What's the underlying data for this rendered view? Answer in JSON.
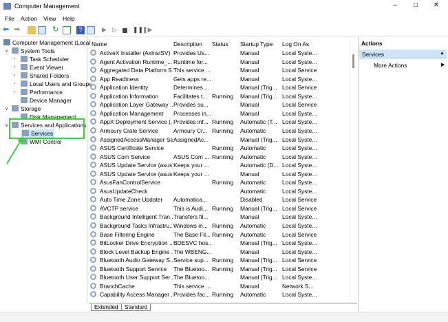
{
  "window": {
    "title": "Computer Management"
  },
  "menu": [
    "File",
    "Action",
    "View",
    "Help"
  ],
  "tree": {
    "root": "Computer Management (Local",
    "items": [
      {
        "label": "System Tools",
        "level": 1,
        "chev": "v"
      },
      {
        "label": "Task Scheduler",
        "level": 2,
        "chev": ">"
      },
      {
        "label": "Event Viewer",
        "level": 2,
        "chev": ">"
      },
      {
        "label": "Shared Folders",
        "level": 2,
        "chev": ">"
      },
      {
        "label": "Local Users and Groups",
        "level": 2,
        "chev": ">"
      },
      {
        "label": "Performance",
        "level": 2,
        "chev": ">"
      },
      {
        "label": "Device Manager",
        "level": 2,
        "chev": ""
      },
      {
        "label": "Storage",
        "level": 1,
        "chev": "v"
      },
      {
        "label": "Disk Management",
        "level": 2,
        "chev": ""
      },
      {
        "label": "Services and Applications",
        "level": 1,
        "chev": "v"
      },
      {
        "label": "Services",
        "level": 2,
        "chev": "",
        "selected": true
      },
      {
        "label": "WMI Control",
        "level": 2,
        "chev": ""
      }
    ]
  },
  "columns": [
    "Name",
    "Description",
    "Status",
    "Startup Type",
    "Log On As"
  ],
  "services": [
    [
      "ActiveX Installer (AxInstSV)",
      "Provides Us...",
      "",
      "Manual",
      "Local Syste..."
    ],
    [
      "Agent Activation Runtime_...",
      "Runtime for...",
      "",
      "Manual",
      "Local Syste..."
    ],
    [
      "Aggregated Data Platform S...",
      "This service ...",
      "",
      "Manual",
      "Local Service"
    ],
    [
      "App Readiness",
      "Gets apps re...",
      "",
      "Manual",
      "Local Syste..."
    ],
    [
      "Application Identity",
      "Determines ...",
      "",
      "Manual (Trig...",
      "Local Service"
    ],
    [
      "Application Information",
      "Facilitates t...",
      "Running",
      "Manual (Trig...",
      "Local Syste..."
    ],
    [
      "Application Layer Gateway ...",
      "Provides su...",
      "",
      "Manual",
      "Local Service"
    ],
    [
      "Application Management",
      "Processes in...",
      "",
      "Manual",
      "Local Syste..."
    ],
    [
      "AppX Deployment Service (...",
      "Provides inf...",
      "Running",
      "Automatic (T...",
      "Local Syste..."
    ],
    [
      "Armoury Crate Service",
      "Armoury Cr...",
      "Running",
      "Automatic",
      "Local Syste..."
    ],
    [
      "AssignedAccessManager Se...",
      "AssignedAc...",
      "",
      "Manual (Trig...",
      "Local Syste..."
    ],
    [
      "ASUS Certificate Service",
      "",
      "Running",
      "Automatic",
      "Local Syste..."
    ],
    [
      "ASUS Com Service",
      "ASUS Com ...",
      "Running",
      "Automatic",
      "Local Syste..."
    ],
    [
      "ASUS Update Service (asus)",
      "Keeps your ...",
      "",
      "Automatic (D...",
      "Local Syste..."
    ],
    [
      "ASUS Update Service (asusm)",
      "Keeps your ...",
      "",
      "Manual",
      "Local Syste..."
    ],
    [
      "AsusFanControlService",
      "",
      "Running",
      "Automatic",
      "Local Syste..."
    ],
    [
      "AsusUpdateCheck",
      "",
      "",
      "Automatic",
      "Local Syste..."
    ],
    [
      "Auto Time Zone Updater",
      "Automatica...",
      "",
      "Disabled",
      "Local Service"
    ],
    [
      "AVCTP service",
      "This is Audi...",
      "Running",
      "Manual (Trig...",
      "Local Service"
    ],
    [
      "Background Intelligent Tran...",
      "Transfers fil...",
      "",
      "Manual",
      "Local Syste..."
    ],
    [
      "Background Tasks Infrastru...",
      "Windows in...",
      "Running",
      "Automatic",
      "Local Syste..."
    ],
    [
      "Base Filtering Engine",
      "The Base Fil...",
      "Running",
      "Automatic",
      "Local Service"
    ],
    [
      "BitLocker Drive Encryption ...",
      "BDESVC hos...",
      "",
      "Manual (Trig...",
      "Local Syste..."
    ],
    [
      "Block Level Backup Engine ...",
      "The WBENG...",
      "",
      "Manual",
      "Local Syste..."
    ],
    [
      "Bluetooth Audio Gateway S...",
      "Service sup...",
      "Running",
      "Manual (Trig...",
      "Local Service"
    ],
    [
      "Bluetooth Support Service",
      "The Bluetoo...",
      "Running",
      "Manual (Trig...",
      "Local Service"
    ],
    [
      "Bluetooth User Support Ser...",
      "The Bluetoo...",
      "",
      "Manual (Trig...",
      "Local Syste..."
    ],
    [
      "BranchCache",
      "This service ...",
      "",
      "Manual",
      "Network S..."
    ],
    [
      "Capability Access Manager ...",
      "Provides fac...",
      "Running",
      "Automatic",
      "Local Syste..."
    ]
  ],
  "tabs": [
    "Extended",
    "Standard"
  ],
  "actions": {
    "header": "Actions",
    "section": "Services",
    "more": "More Actions"
  },
  "colors": {
    "highlight": "#3bd13b",
    "section_bg": "#cfe3f7"
  }
}
